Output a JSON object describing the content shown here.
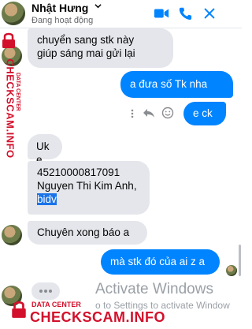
{
  "header": {
    "name": "Nhật Hưng",
    "status": "Đang hoạt động"
  },
  "messages": [
    {
      "side": "in",
      "text_lines": [
        "chuyển sang stk này",
        "giúp sáng mai gửi lại"
      ]
    },
    {
      "side": "out",
      "text": "a đưa số Tk nha"
    },
    {
      "side": "out",
      "text": "e ck"
    },
    {
      "side": "in",
      "text": "Uk e"
    },
    {
      "side": "in",
      "text_lines": [
        "45210000817091",
        "Nguyen Thi Kim Anh,",
        "bidv"
      ]
    },
    {
      "side": "in",
      "text": "Chuyên xong báo a"
    },
    {
      "side": "out",
      "text": "mà stk đó của ai z a"
    }
  ],
  "watermark": {
    "brand": "CHECKSCAM.INFO",
    "center": "DATA CENTER"
  },
  "os_overlay": {
    "line1": "Activate Windows",
    "line2": "o to Settings to activate Window"
  },
  "colors": {
    "messenger_blue": "#0084ff",
    "incoming_bubble": "#e4e6eb",
    "watermark_red": "#d3102b"
  },
  "icons": {
    "header": [
      "chevron-down-icon",
      "video-call-icon",
      "phone-icon",
      "close-icon"
    ],
    "message_actions": [
      "more-icon",
      "reply-icon",
      "emoji-icon"
    ]
  }
}
